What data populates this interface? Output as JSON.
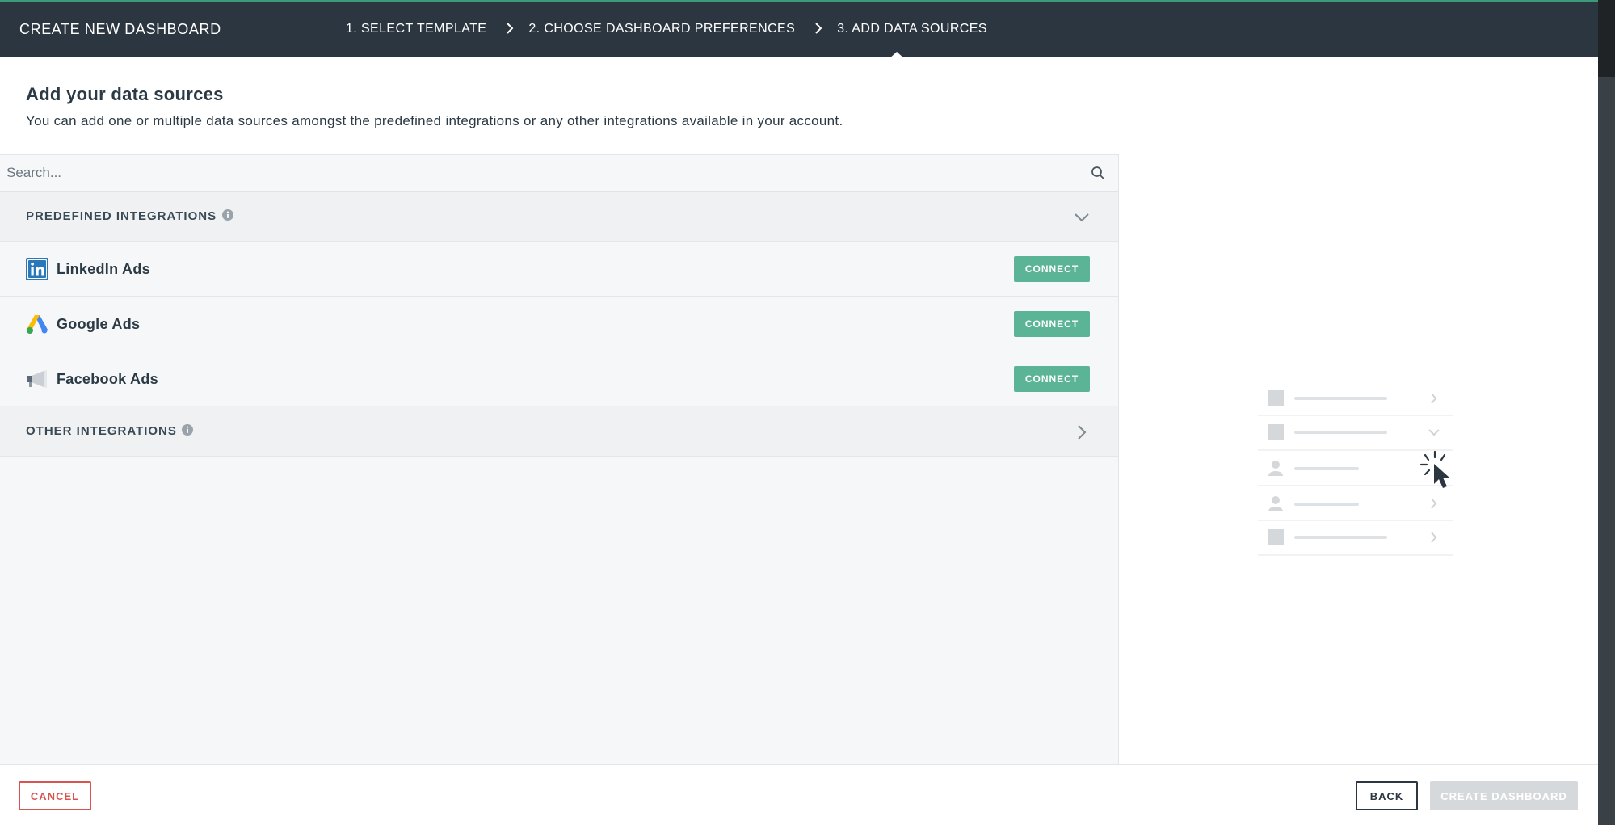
{
  "header": {
    "title": "CREATE NEW DASHBOARD",
    "steps": [
      {
        "label": "1. SELECT TEMPLATE",
        "active": false
      },
      {
        "label": "2. CHOOSE DASHBOARD PREFERENCES",
        "active": false
      },
      {
        "label": "3. ADD DATA SOURCES",
        "active": true
      }
    ],
    "accent_color": "#2b3640"
  },
  "intro": {
    "heading": "Add your data sources",
    "description": "You can add one or multiple data sources amongst the predefined integrations or any other integrations available in your account."
  },
  "search": {
    "placeholder": "Search...",
    "value": "",
    "icon": "search-icon"
  },
  "predefined": {
    "label": "PREDEFINED INTEGRATIONS",
    "expanded": true,
    "items": [
      {
        "name": "LinkedIn Ads",
        "icon": "linkedin-icon",
        "action": "CONNECT"
      },
      {
        "name": "Google Ads",
        "icon": "google-ads-icon",
        "action": "CONNECT"
      },
      {
        "name": "Facebook Ads",
        "icon": "megaphone-icon",
        "action": "CONNECT"
      }
    ]
  },
  "other": {
    "label": "OTHER INTEGRATIONS",
    "expanded": false
  },
  "footer": {
    "cancel_label": "CANCEL",
    "back_label": "BACK",
    "create_label": "CREATE DASHBOARD",
    "create_enabled": false
  },
  "colors": {
    "connect_button": "#5bb495",
    "cancel": "#d9534f",
    "disabled": "#d6d9dc"
  }
}
